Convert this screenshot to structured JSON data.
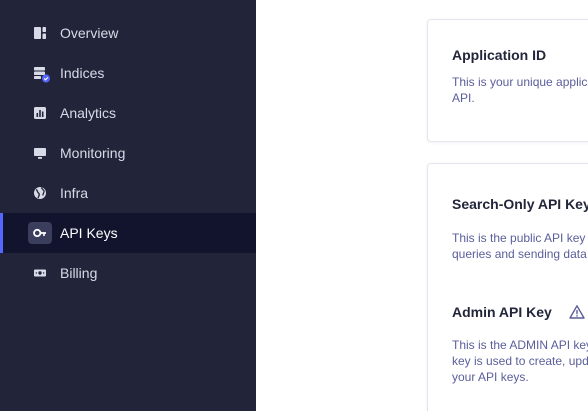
{
  "sidebar": {
    "items": [
      {
        "label": "Overview",
        "icon": "overview-icon",
        "active": false
      },
      {
        "label": "Indices",
        "icon": "indices-icon",
        "active": false
      },
      {
        "label": "Analytics",
        "icon": "analytics-icon",
        "active": false
      },
      {
        "label": "Monitoring",
        "icon": "monitoring-icon",
        "active": false
      },
      {
        "label": "Infra",
        "icon": "infra-globe-icon",
        "active": false
      },
      {
        "label": "API Keys",
        "icon": "key-icon",
        "active": true
      },
      {
        "label": "Billing",
        "icon": "billing-icon",
        "active": false
      }
    ],
    "accent_color": "#5468ff",
    "background_color": "#222539"
  },
  "main": {
    "application_id_card": {
      "title": "Application ID",
      "description_lines": [
        "This is your unique applica",
        "API."
      ]
    },
    "keys_card": {
      "search_only": {
        "title": "Search-Only API Key",
        "description_lines": [
          "This is the public API key t",
          "queries and sending data"
        ]
      },
      "admin": {
        "title": "Admin API Key",
        "warning_icon": "warning-icon",
        "description_lines": [
          "This is the ADMIN API key",
          "key is used to create, upda",
          "your API keys."
        ]
      }
    }
  }
}
